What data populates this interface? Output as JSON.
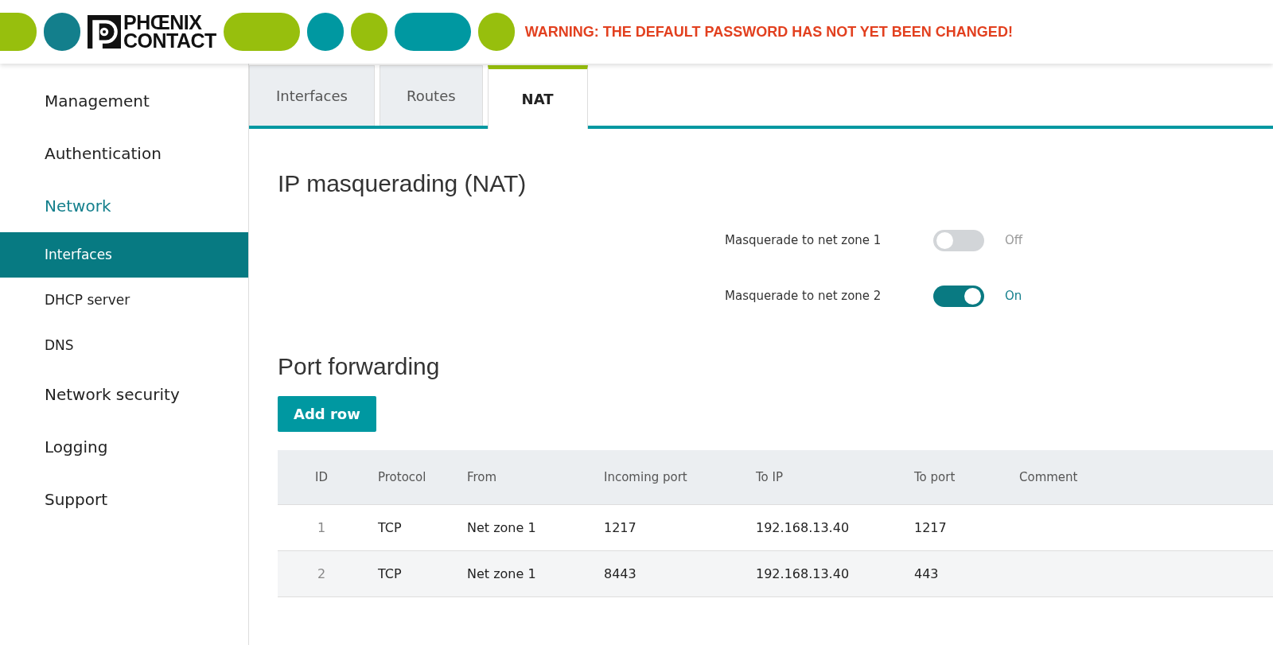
{
  "header": {
    "logo": {
      "line_1": "PHŒNIX",
      "line_2": "CONTACT"
    },
    "warning": "WARNING: THE DEFAULT PASSWORD HAS NOT YET BEEN CHANGED!"
  },
  "sidebar": {
    "items": [
      {
        "label": "Management",
        "selected": false
      },
      {
        "label": "Authentication",
        "selected": false
      },
      {
        "label": "Network",
        "selected": true,
        "expanded": true,
        "children": [
          {
            "label": "Interfaces",
            "selected": true
          },
          {
            "label": "DHCP server",
            "selected": false
          },
          {
            "label": "DNS",
            "selected": false
          }
        ]
      },
      {
        "label": "Network security",
        "selected": false
      },
      {
        "label": "Logging",
        "selected": false
      },
      {
        "label": "Support",
        "selected": false
      }
    ]
  },
  "tabs": [
    {
      "label": "Interfaces",
      "selected": false
    },
    {
      "label": "Routes",
      "selected": false
    },
    {
      "label": "NAT",
      "selected": true
    }
  ],
  "masquerading": {
    "title": "IP masquerading (NAT)",
    "toggles": [
      {
        "label": "Masquerade to net zone 1",
        "on": false,
        "state": "Off"
      },
      {
        "label": "Masquerade to net zone 2",
        "on": true,
        "state": "On"
      }
    ]
  },
  "port_forwarding": {
    "title": "Port forwarding",
    "add_button": "Add row",
    "table": {
      "columns": [
        "ID",
        "Protocol",
        "From",
        "Incoming port",
        "To IP",
        "To port",
        "Comment"
      ],
      "rows": [
        [
          "1",
          "TCP",
          "Net zone 1",
          "1217",
          "192.168.13.40",
          "1217",
          ""
        ],
        [
          "2",
          "TCP",
          "Net zone 1",
          "8443",
          "192.168.13.40",
          "443",
          ""
        ]
      ]
    }
  }
}
